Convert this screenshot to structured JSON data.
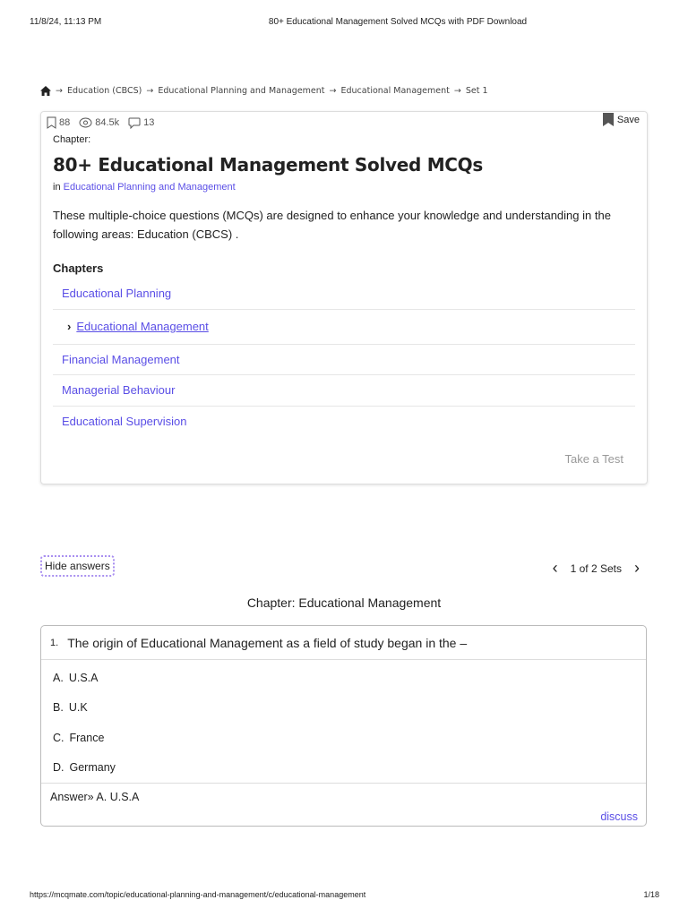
{
  "print_header": {
    "datetime": "11/8/24, 11:13 PM",
    "title": "80+ Educational Management Solved MCQs with PDF Download"
  },
  "breadcrumb": [
    "Education (CBCS)",
    "Educational Planning and Management",
    "Educational Management",
    "Set 1"
  ],
  "stats": {
    "bookmarks": "88",
    "views": "84.5k",
    "comments": "13"
  },
  "save_label": "Save",
  "chapter_label": "Chapter:",
  "title": "80+ Educational Management Solved MCQs",
  "in_label": "in",
  "in_link": "Educational Planning and Management",
  "description": "These multiple-choice questions (MCQs) are designed to enhance your knowledge and understanding in the following areas: Education (CBCS) .",
  "chapters_heading": "Chapters",
  "chapters": [
    "Educational Planning",
    "Educational Management",
    "Financial Management",
    "Managerial Behaviour",
    "Educational Supervision"
  ],
  "take_test": "Take a Test",
  "hide_answers": "Hide answers",
  "pager": "1 of 2 Sets",
  "section_title": "Chapter: Educational Management",
  "question": {
    "number": "1.",
    "text": "The origin of Educational Management as a field of study began in the –",
    "options": [
      {
        "letter": "A.",
        "text": "U.S.A"
      },
      {
        "letter": "B.",
        "text": "U.K"
      },
      {
        "letter": "C.",
        "text": "France"
      },
      {
        "letter": "D.",
        "text": "Germany"
      }
    ],
    "answer": "Answer» A. U.S.A",
    "discuss": "discuss"
  },
  "print_footer": {
    "url": "https://mcqmate.com/topic/educational-planning-and-management/c/educational-management",
    "page": "1/18"
  }
}
